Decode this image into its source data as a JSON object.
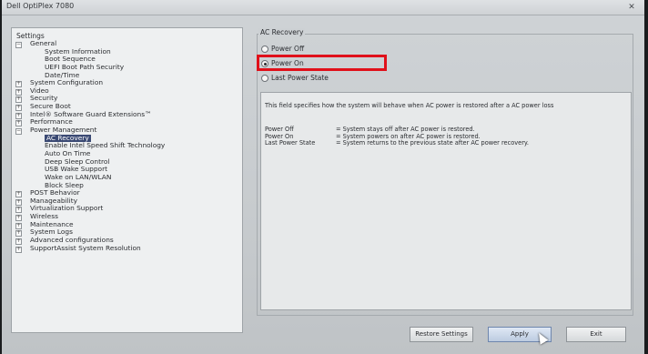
{
  "window": {
    "title": "Dell OptiPlex 7080",
    "close_glyph": "✕"
  },
  "tree": {
    "heading": "Settings",
    "items": [
      {
        "label": "General",
        "exp": "−"
      },
      {
        "label": "System Information",
        "exp": ""
      },
      {
        "label": "Boot Sequence",
        "exp": ""
      },
      {
        "label": "UEFI Boot Path Security",
        "exp": ""
      },
      {
        "label": "Date/Time",
        "exp": ""
      },
      {
        "label": "System Configuration",
        "exp": "+"
      },
      {
        "label": "Video",
        "exp": "+"
      },
      {
        "label": "Security",
        "exp": "+"
      },
      {
        "label": "Secure Boot",
        "exp": "+"
      },
      {
        "label": "Intel® Software Guard Extensions™",
        "exp": "+"
      },
      {
        "label": "Performance",
        "exp": "+"
      },
      {
        "label": "Power Management",
        "exp": "−"
      },
      {
        "label": "AC Recovery",
        "exp": "",
        "selected": true
      },
      {
        "label": "Enable Intel Speed Shift Technology",
        "exp": ""
      },
      {
        "label": "Auto On Time",
        "exp": ""
      },
      {
        "label": "Deep Sleep Control",
        "exp": ""
      },
      {
        "label": "USB Wake Support",
        "exp": ""
      },
      {
        "label": "Wake on LAN/WLAN",
        "exp": ""
      },
      {
        "label": "Block Sleep",
        "exp": ""
      },
      {
        "label": "POST Behavior",
        "exp": "+"
      },
      {
        "label": "Manageability",
        "exp": "+"
      },
      {
        "label": "Virtualization Support",
        "exp": "+"
      },
      {
        "label": "Wireless",
        "exp": "+"
      },
      {
        "label": "Maintenance",
        "exp": "+"
      },
      {
        "label": "System Logs",
        "exp": "+"
      },
      {
        "label": "Advanced configurations",
        "exp": "+"
      },
      {
        "label": "SupportAssist System Resolution",
        "exp": "+"
      }
    ]
  },
  "panel": {
    "legend": "AC Recovery",
    "options": [
      {
        "label": "Power Off",
        "selected": false
      },
      {
        "label": "Power On",
        "selected": true
      },
      {
        "label": "Last Power State",
        "selected": false
      }
    ],
    "description": "This field specifies how the system will behave when AC power is restored after a AC power loss",
    "table": [
      {
        "key": "Power Off",
        "value": "= System stays off after AC power is restored."
      },
      {
        "key": "Power On",
        "value": "= System powers on after AC power is restored."
      },
      {
        "key": "Last Power State",
        "value": "= System returns to the previous state after AC power recovery."
      }
    ]
  },
  "buttons": {
    "restore": "Restore Settings",
    "apply": "Apply",
    "exit": "Exit"
  },
  "colors": {
    "highlight": "#e0101a",
    "selection": "#3b4a74"
  }
}
